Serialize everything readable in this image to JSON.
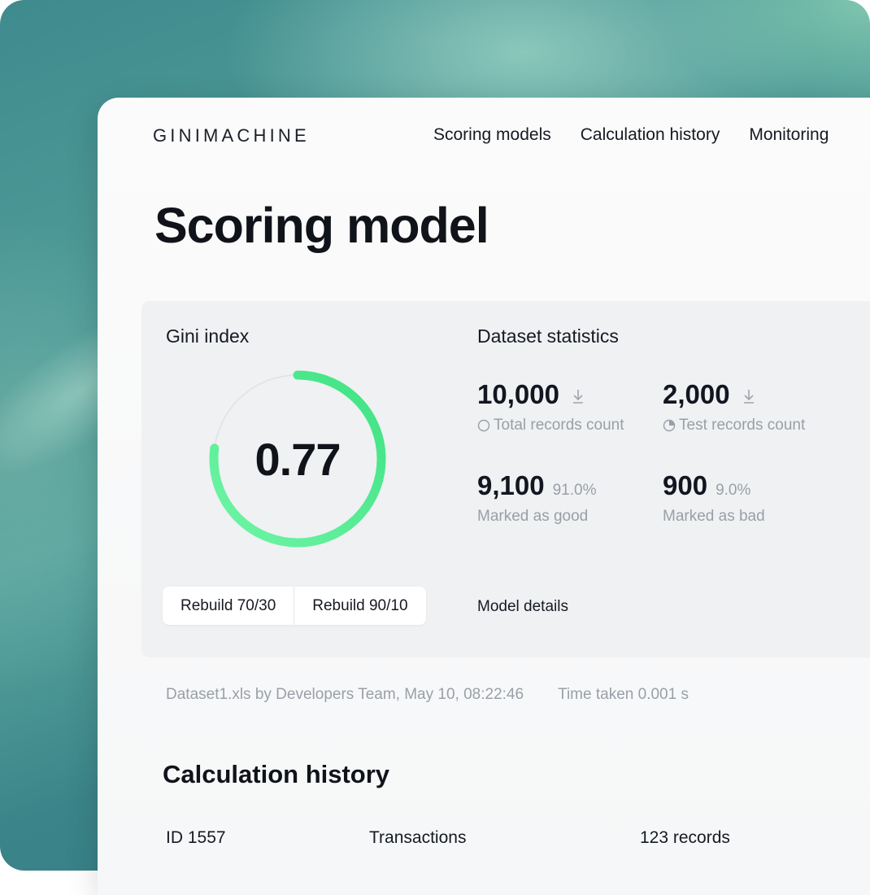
{
  "header": {
    "logo": "GINIMACHINE",
    "nav": [
      "Scoring models",
      "Calculation history",
      "Monitoring"
    ]
  },
  "page_title": "Scoring model",
  "gini": {
    "label": "Gini index",
    "value": "0.77",
    "gauge_fraction": 0.77,
    "gauge_color": "#4ee98c",
    "buttons": [
      "Rebuild 70/30",
      "Rebuild 90/10"
    ]
  },
  "dataset": {
    "title": "Dataset statistics",
    "total": {
      "value": "10,000",
      "label": "Total records count",
      "icon": "circle-icon"
    },
    "test": {
      "value": "2,000",
      "label": "Test records count",
      "icon": "pie-icon"
    },
    "good": {
      "value": "9,100",
      "pct": "91.0%",
      "label": "Marked as good"
    },
    "bad": {
      "value": "900",
      "pct": "9.0%",
      "label": "Marked as bad"
    },
    "details_link": "Model details"
  },
  "meta": {
    "source": "Dataset1.xls by Developers Team, May 10, 08:22:46",
    "time": "Time taken 0.001 s"
  },
  "history": {
    "title": "Calculation history",
    "rows": [
      {
        "id": "ID 1557",
        "name": "Transactions",
        "records": "123 records"
      }
    ]
  }
}
